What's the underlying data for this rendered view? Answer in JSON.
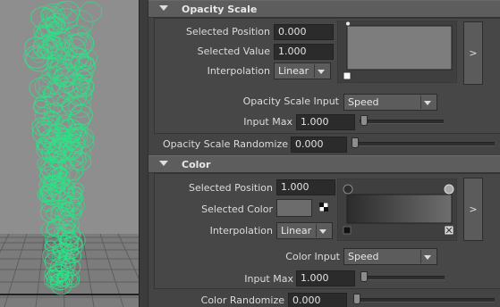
{
  "opacity": {
    "title": "Opacity Scale",
    "selected_position_label": "Selected Position",
    "selected_position_value": "0.000",
    "selected_value_label": "Selected Value",
    "selected_value_value": "1.000",
    "interpolation_label": "Interpolation",
    "interpolation_value": "Linear",
    "input_label": "Opacity Scale Input",
    "input_value": "Speed",
    "input_max_label": "Input Max",
    "input_max_value": "1.000",
    "expand_label": ">",
    "randomize_label": "Opacity Scale Randomize",
    "randomize_value": "0.000"
  },
  "color": {
    "title": "Color",
    "selected_position_label": "Selected Position",
    "selected_position_value": "1.000",
    "selected_color_label": "Selected Color",
    "interpolation_label": "Interpolation",
    "interpolation_value": "Linear",
    "input_label": "Color Input",
    "input_value": "Speed",
    "input_max_label": "Input Max",
    "input_max_value": "1.000",
    "expand_label": ">",
    "randomize_label": "Color Randomize",
    "randomize_value": "0.000"
  }
}
